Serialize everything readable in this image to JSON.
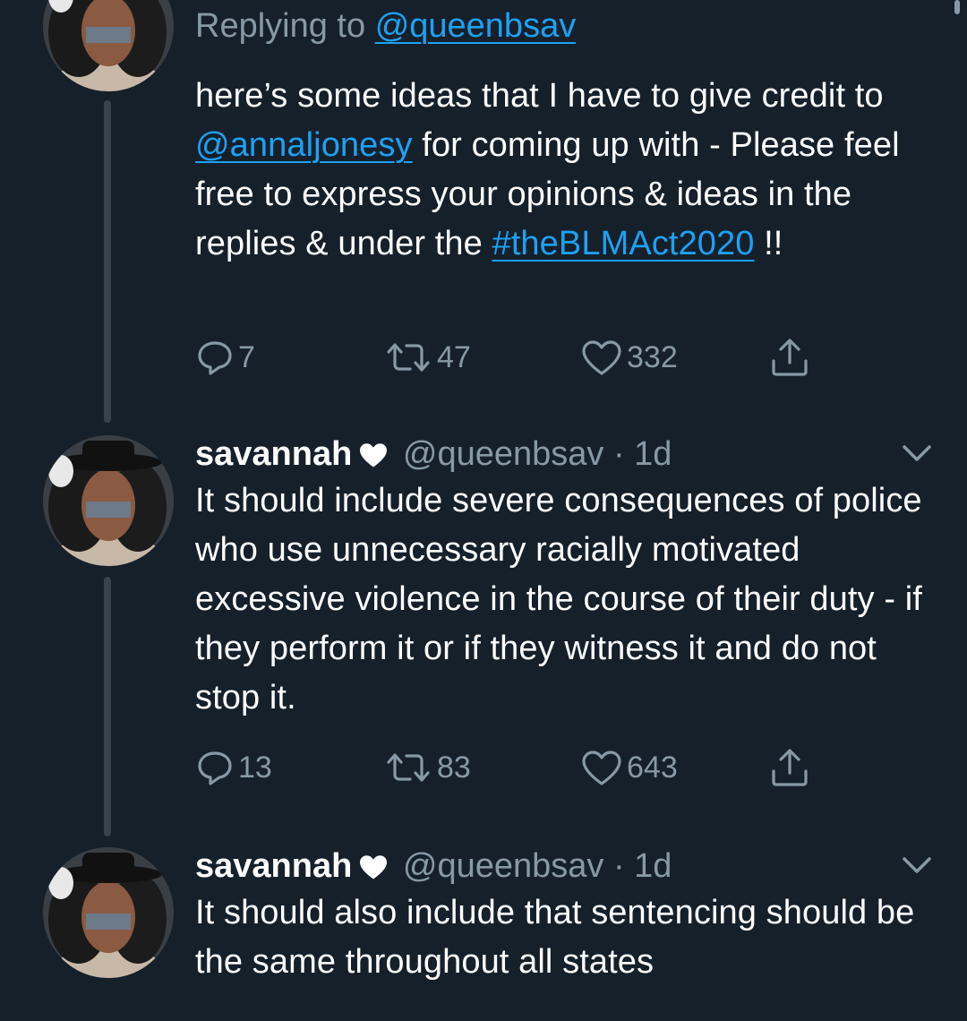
{
  "colors": {
    "background": "#15202b",
    "text": "#ffffff",
    "muted": "#8899a6",
    "link": "#1da1f2",
    "divider": "#38444d"
  },
  "icons": {
    "reply": "comment-bubble-icon",
    "retweet": "retweet-arrows-icon",
    "like": "heart-outline-icon",
    "share": "share-upload-icon",
    "name_badge": "white-heart-emoji",
    "menu": "chevron-down-icon"
  },
  "tweets": [
    {
      "replying_prefix": "Replying to",
      "replying_handle": "@queenbsav",
      "text_parts": [
        "here’s some ideas that I have to give credit to ",
        "@annaljonesy",
        " for coming up with - Please feel free to express your opinions & ideas in the replies & under the ",
        "#theBLMAct2020",
        " !!"
      ],
      "replies": "7",
      "retweets": "47",
      "likes": "332"
    },
    {
      "name": "savannah",
      "handle": "@queenbsav",
      "separator": "·",
      "time": "1d",
      "text": "It should include severe consequences of police who use unnecessary racially motivated excessive violence in the course of their duty - if they perform it or if they witness it and do not stop it.",
      "replies": "13",
      "retweets": "83",
      "likes": "643"
    },
    {
      "name": "savannah",
      "handle": "@queenbsav",
      "separator": "·",
      "time": "1d",
      "text": "It should also include that sentencing should be the same throughout all states"
    }
  ]
}
